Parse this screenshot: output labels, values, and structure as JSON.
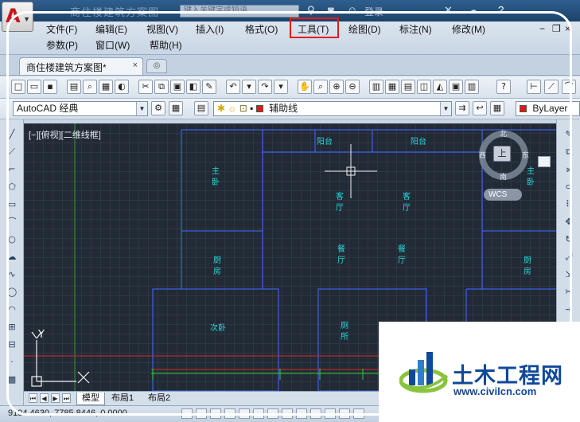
{
  "window": {
    "title": "商住楼建筑方案图",
    "search_placeholder": "键入关键字或短语",
    "login_label": "登录"
  },
  "menu": {
    "row1": [
      "文件(F)",
      "编辑(E)",
      "视图(V)",
      "插入(I)",
      "格式(O)",
      "工具(T)",
      "绘图(D)",
      "标注(N)",
      "修改(M)"
    ],
    "row2": [
      "参数(P)",
      "窗口(W)",
      "帮助(H)"
    ],
    "highlighted": "工具(T)",
    "highlight_color": "#e51a1a"
  },
  "tabs": {
    "document": "商住楼建筑方案图*"
  },
  "toolbar2": {
    "workspace": "AutoCAD 经典",
    "layer": "辅助线",
    "color": "ByLayer"
  },
  "canvas": {
    "view_label": "[−][俯视][二维线框]",
    "rooms": {
      "balcony_1": "阳台",
      "balcony_2": "阳台",
      "master_bedroom_1": "主卧",
      "master_bedroom_2": "主卧",
      "living_1": "客厅",
      "living_2": "客厅",
      "kitchen_1": "厨房",
      "kitchen_2": "厨房",
      "dining_1": "餐厅",
      "dining_2": "餐厅",
      "second_bedroom": "次卧",
      "toilet": "厕所"
    },
    "viewcube": {
      "north": "北",
      "south": "南",
      "east": "东",
      "west": "西",
      "top": "上",
      "wcs": "WCS"
    },
    "ucs": {
      "x_label": "X",
      "y_label": "Y"
    }
  },
  "layouts": {
    "model": "模型",
    "layout1": "布局1",
    "layout2": "布局2"
  },
  "status": {
    "coords": "9194.4630, 7785.8446, 0.0000"
  },
  "watermark": {
    "title": "土木工程网",
    "url": "www.civilcn.com"
  }
}
